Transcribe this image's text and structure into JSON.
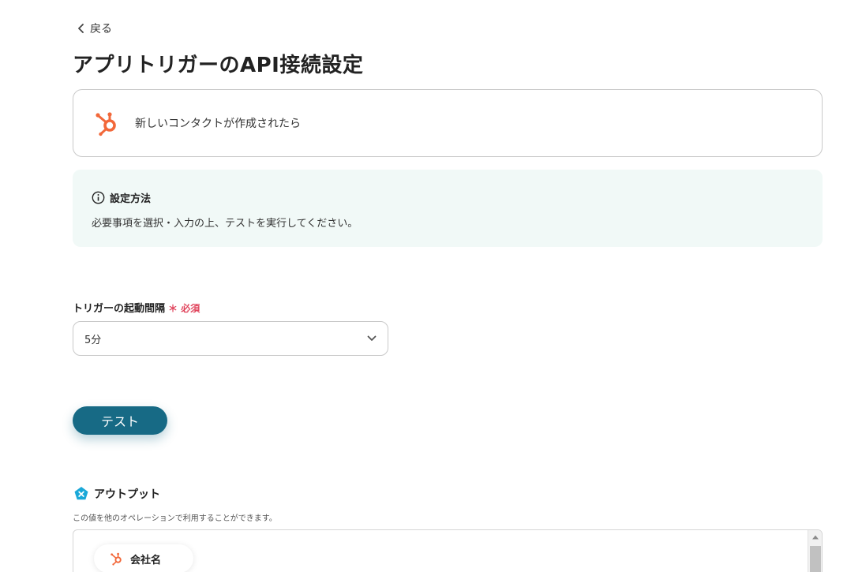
{
  "nav": {
    "back_label": "戻る"
  },
  "page": {
    "title": "アプリトリガーのAPI接続設定"
  },
  "app_card": {
    "icon": "hubspot-icon",
    "label": "新しいコンタクトが作成されたら"
  },
  "info": {
    "heading": "設定方法",
    "body": "必要事項を選択・入力の上、テストを実行してください。"
  },
  "trigger_interval": {
    "label": "トリガーの起動間隔",
    "required_label": "＊ 必須",
    "selected_value": "5分"
  },
  "test_button": {
    "label": "テスト"
  },
  "output": {
    "heading": "アウトプット",
    "description": "この値を他のオペレーションで利用することができます。",
    "items": [
      {
        "icon": "hubspot-icon",
        "label": "会社名"
      }
    ]
  },
  "colors": {
    "primary": "#176a85",
    "required": "#e0445c",
    "hubspot": "#f2683a",
    "info_bg": "#f1f9f7",
    "output_icon": "#1aa8d8"
  }
}
